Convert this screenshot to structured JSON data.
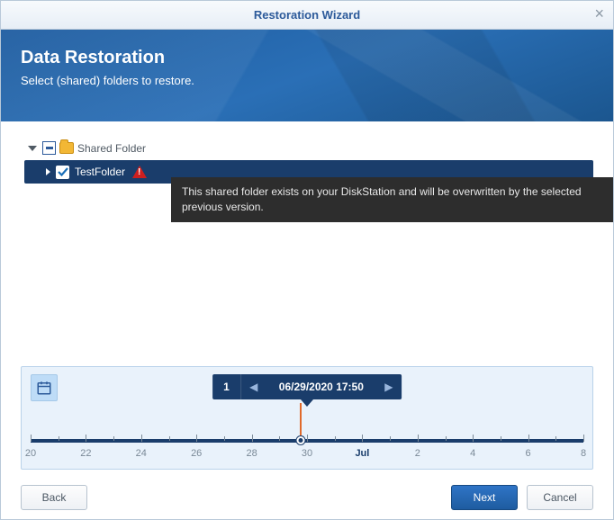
{
  "window": {
    "title": "Restoration Wizard"
  },
  "banner": {
    "heading": "Data Restoration",
    "subheading": "Select (shared) folders to restore."
  },
  "tree": {
    "root_label": "Shared Folder",
    "child_label": "TestFolder"
  },
  "tooltip": {
    "text": "This shared folder exists on your DiskStation and will be overwritten by the selected previous version."
  },
  "timeline": {
    "count": "1",
    "datetime": "06/29/2020 17:50",
    "ticks": [
      "20",
      "22",
      "24",
      "26",
      "28",
      "30",
      "Jul",
      "2",
      "4",
      "6",
      "8"
    ],
    "month_tick_index": 6,
    "marker_position_percent": 48.9
  },
  "buttons": {
    "back": "Back",
    "next": "Next",
    "cancel": "Cancel"
  }
}
